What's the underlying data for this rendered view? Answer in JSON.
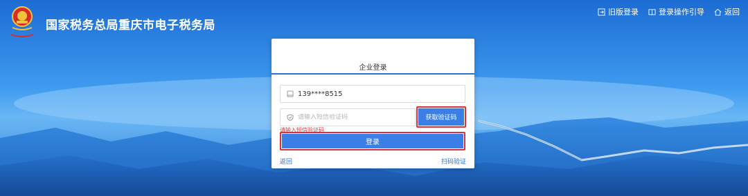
{
  "header": {
    "site_title": "国家税务总局重庆市电子税务局",
    "links": {
      "old_version": "旧版登录",
      "guide": "登录操作引导",
      "back": "返回"
    }
  },
  "login": {
    "tab_label": "企业登录",
    "phone_value": "139****8515",
    "code_placeholder": "请输入短信验证码",
    "get_code_label": "获取验证码",
    "error_text": "请输入短信验证码",
    "login_label": "登录",
    "back_link": "返回",
    "scan_link": "扫码验证"
  },
  "colors": {
    "accent": "#3b7ee6",
    "highlight_border": "#e02f38",
    "link": "#2d6fd6"
  }
}
